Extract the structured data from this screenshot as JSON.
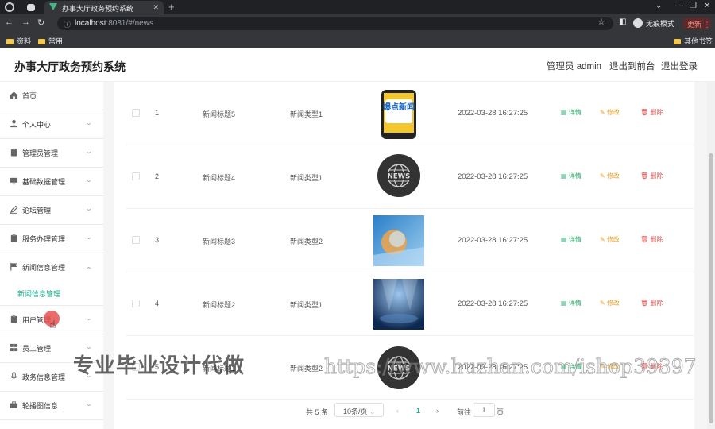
{
  "browser": {
    "tab_title": "办事大厅政务预约系统",
    "url_host": "localhost",
    "url_path": ":8081/#/news",
    "guest_mode": "无痕模式",
    "update_label": "更新",
    "bookmarks": [
      "资料",
      "常用"
    ],
    "other_bookmarks": "其他书签"
  },
  "header": {
    "title": "办事大厅政务预约系统",
    "user": "管理员 admin",
    "front_link": "退出到前台",
    "logout_link": "退出登录"
  },
  "sidebar": {
    "items": [
      {
        "label": "首页",
        "icon": "home-icon"
      },
      {
        "label": "个人中心",
        "icon": "user-icon"
      },
      {
        "label": "管理员管理",
        "icon": "clipboard-icon"
      },
      {
        "label": "基础数据管理",
        "icon": "monitor-icon"
      },
      {
        "label": "论坛管理",
        "icon": "pen-icon"
      },
      {
        "label": "服务办理管理",
        "icon": "clipboard-icon"
      },
      {
        "label": "新闻信息管理",
        "icon": "flag-icon"
      },
      {
        "label": "用户管理",
        "icon": "clipboard-icon"
      },
      {
        "label": "员工管理",
        "icon": "grid-icon"
      },
      {
        "label": "政务信息管理",
        "icon": "microphone-icon"
      },
      {
        "label": "轮播图信息",
        "icon": "briefcase-icon"
      }
    ],
    "active_submenu": "新闻信息管理"
  },
  "table": {
    "rows": [
      {
        "index": "1",
        "title": "新闻标题5",
        "type": "新闻类型1",
        "image_text": "爆点新闻",
        "time": "2022-03-28 16:27:25"
      },
      {
        "index": "2",
        "title": "新闻标题4",
        "type": "新闻类型1",
        "image_text": "NEWS",
        "time": "2022-03-28 16:27:25"
      },
      {
        "index": "3",
        "title": "新闻标题3",
        "type": "新闻类型2",
        "image_text": "",
        "time": "2022-03-28 16:27:25"
      },
      {
        "index": "4",
        "title": "新闻标题2",
        "type": "新闻类型1",
        "image_text": "",
        "time": "2022-03-28 16:27:25"
      },
      {
        "index": "5",
        "title": "新闻标题1",
        "type": "新闻类型2",
        "image_text": "NEWS",
        "time": "2022-03-28 16:27:25"
      }
    ],
    "actions": {
      "detail": "详情",
      "edit": "修改",
      "delete": "删除"
    }
  },
  "pagination": {
    "total": "共 5 条",
    "page_size": "10条/页",
    "current_page": "1",
    "goto_label": "前往",
    "page_unit": "页"
  },
  "watermark": {
    "left": "专业毕业设计代做",
    "right": "https://www.huzhan.com/ishop39397"
  },
  "colors": {
    "accent": "#1aad8f",
    "detail": "#25a765",
    "edit": "#f0a020",
    "delete": "#e05050"
  }
}
